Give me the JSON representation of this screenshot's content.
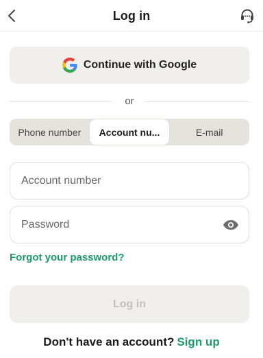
{
  "header": {
    "title": "Log in",
    "back_icon": "chevron-left-icon",
    "support_icon": "headset-icon"
  },
  "google": {
    "label": "Continue with Google",
    "icon": "google-logo-icon"
  },
  "divider": {
    "text": "or"
  },
  "tabs": [
    {
      "label": "Phone number",
      "active": false
    },
    {
      "label": "Account nu...",
      "active": true
    },
    {
      "label": "E-mail",
      "active": false
    }
  ],
  "form": {
    "account_placeholder": "Account number",
    "account_value": "",
    "password_placeholder": "Password",
    "password_value": "",
    "eye_icon": "eye-icon"
  },
  "forgot_label": "Forgot your password?",
  "login_label": "Log in",
  "signup": {
    "prompt": "Don't have an account?",
    "link": "Sign up"
  },
  "colors": {
    "accent": "#1c9a6b",
    "button_bg": "#f1efeb",
    "tab_bg": "#e6e3de",
    "disabled_text": "#c2c0bd"
  }
}
